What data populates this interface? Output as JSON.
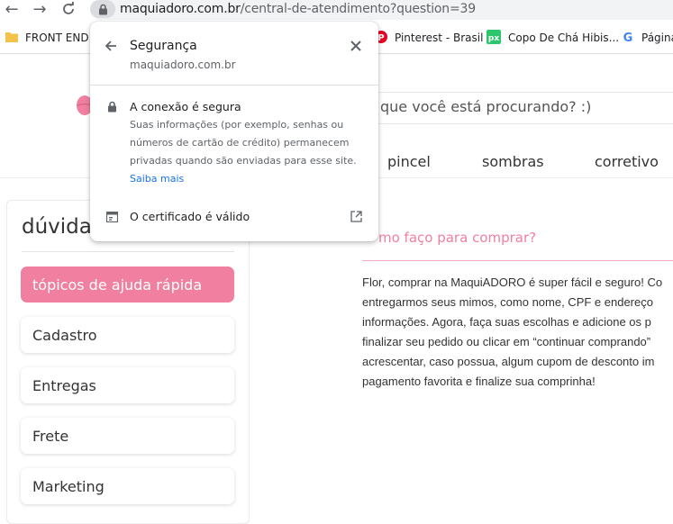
{
  "browser": {
    "url_domain": "maquiadoro.com.br",
    "url_path": "/central-de-atendimento?question=39",
    "bookmarks": [
      {
        "label": "FRONT END",
        "icon": "folder-icon"
      },
      {
        "label": "Pinterest - Brasil",
        "icon": "pinterest-icon"
      },
      {
        "label": "Copo De Chá Hibis...",
        "icon": "pixabay-icon"
      },
      {
        "label": "Página",
        "icon": "google-icon"
      }
    ]
  },
  "popup": {
    "title": "Segurança",
    "domain": "maquiadoro.com.br",
    "secure_heading": "A conexão é segura",
    "secure_desc": [
      "Suas informações (por exemplo, senhas ou",
      "números de cartão de crédito) permanecem",
      "privadas quando são enviadas para esse site."
    ],
    "learn_more": "Saiba mais",
    "certificate": "O certificado é válido"
  },
  "site": {
    "search_placeholder": "que você está procurando? :)",
    "categories": [
      "pincel",
      "sombras",
      "corretivo"
    ],
    "accent_color": "#f07fa0"
  },
  "help": {
    "title": "dúvidas",
    "topics": [
      "tópicos de ajuda rápida",
      "Cadastro",
      "Entregas",
      "Frete",
      "Marketing"
    ],
    "question": "mo faço para comprar?",
    "answer_lines": [
      "Flor, comprar na MaquiADORO é super fácil e seguro! Co",
      "entregarmos seus mimos, como nome, CPF e endereço",
      "informações. Agora, faça suas escolhas e adicione os p",
      "finalizar seu pedido ou clicar em “continuar comprando”",
      "acrescentar, caso possua, algum cupom de desconto im",
      "pagamento favorita e finalize sua comprinha!"
    ]
  }
}
